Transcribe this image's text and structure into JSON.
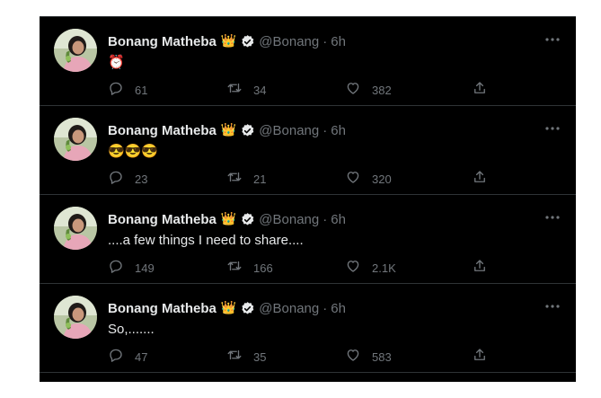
{
  "tweets": [
    {
      "name": "Bonang Matheba",
      "crown": "👑",
      "handle": "@Bonang",
      "time": "6h",
      "text": "⏰",
      "replies": "61",
      "retweets": "34",
      "likes": "382"
    },
    {
      "name": "Bonang Matheba",
      "crown": "👑",
      "handle": "@Bonang",
      "time": "6h",
      "text": "😎😎😎",
      "replies": "23",
      "retweets": "21",
      "likes": "320"
    },
    {
      "name": "Bonang Matheba",
      "crown": "👑",
      "handle": "@Bonang",
      "time": "6h",
      "text": "....a few things I need to share....",
      "replies": "149",
      "retweets": "166",
      "likes": "2.1K"
    },
    {
      "name": "Bonang Matheba",
      "crown": "👑",
      "handle": "@Bonang",
      "time": "6h",
      "text": "So,.......",
      "replies": "47",
      "retweets": "35",
      "likes": "583"
    }
  ],
  "separator": "·",
  "icons": {
    "verified": "verified-badge-icon",
    "more": "more-icon",
    "reply": "reply-icon",
    "retweet": "retweet-icon",
    "like": "heart-icon",
    "share": "share-icon"
  },
  "colors": {
    "background": "#000000",
    "primary_text": "#e7e9ea",
    "secondary_text": "#71767b",
    "divider": "#2f3336"
  }
}
